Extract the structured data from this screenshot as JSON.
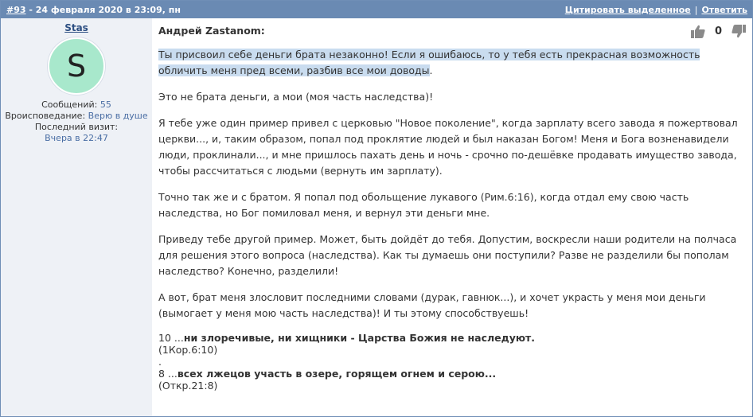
{
  "header": {
    "post_number": "#93",
    "date": " - 24 февраля 2020 в 23:09, пн",
    "quote_selected": "Цитировать выделенное",
    "separator": "|",
    "reply": "Ответить"
  },
  "author": {
    "name": "Stas",
    "avatar_letter": "S",
    "messages_label": "Сообщений:",
    "messages_value": "55",
    "religion_label": "Вроисповедание:",
    "religion_value": "Верю в душе",
    "last_visit_label": "Последний визит:",
    "last_visit_value": "Вчера в 22:47"
  },
  "post": {
    "quote_author": "Андрей Zastanom:",
    "vote_count": "0",
    "quote": "Ты присвоил себе деньги брата незаконно! Если я ошибаюсь, то у тебя есть прекрасная возможность обличить меня пред всеми, разбив все мои доводы",
    "quote_end": ".",
    "paragraphs": [
      "Это не брата деньги, а мои (моя часть наследства)!",
      "Я тебе уже один пример привел с церковью \"Новое поколение\", когда зарплату всего завода я пожертвовал церкви..., и, таким образом, попал под проклятие людей и был наказан Богом! Меня и Бога возненавидели люди, проклинали..., и мне пришлось пахать день и ночь - срочно по-дешёвке продавать имущество завода, чтобы рассчитаться с людьми (вернуть им зарплату).",
      "Точно так же и с братом. Я попал под обольщение лукавого (Рим.6:16), когда отдал ему свою часть наследства, но Бог помиловал меня, и вернул эти деньги мне.",
      "Приведу тебе другой пример. Может, быть дойдёт до тебя. Допустим, воскресли наши родители на полчаса для решения этого вопроса (наследства). Как ты думаешь они поступили? Разве не разделили бы пополам наследство? Конечно, разделили!",
      " А вот, брат меня злословит последними словами (дурак, гавнюк...), и хочет украсть у меня мои деньги (вымогает у меня мою часть наследства)! И ты этому способствуешь!"
    ],
    "verse1_num": "10 ...",
    "verse1_text": "ни злоречивые, ни хищники - Царства Божия не наследуют.",
    "verse1_ref": "(1Кор.6:10)",
    "dot": ".",
    "verse2_num": "8 ...",
    "verse2_text": "всех лжецов участь в озере, горящем огнем и серою...",
    "verse2_ref": "(Откр.21:8)"
  },
  "icons": {
    "like": "thumbs-up-icon",
    "dislike": "thumbs-down-icon"
  },
  "colors": {
    "header_bg": "#6a8ab3",
    "author_bg": "#eef1f6",
    "quote_highlight": "#c9dcef",
    "avatar_bg": "#a8e8cc"
  }
}
